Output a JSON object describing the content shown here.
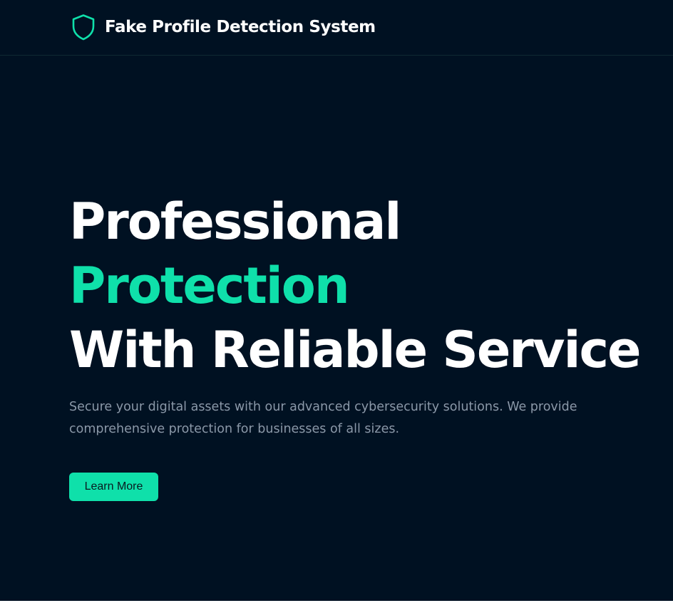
{
  "navbar": {
    "logo_icon": "shield-icon",
    "title": "Fake Profile Detection System"
  },
  "hero": {
    "heading_line1": "Professional",
    "heading_line2": "Protection",
    "heading_line3": "With Reliable Service",
    "description": "Secure your digital assets with our advanced cybersecurity solutions. We provide comprehensive protection for businesses of all sizes.",
    "cta_label": "Learn More"
  },
  "colors": {
    "background": "#001122",
    "accent": "#0fe0aa",
    "heading_text": "#ffffff",
    "body_text": "#8b98a8"
  }
}
